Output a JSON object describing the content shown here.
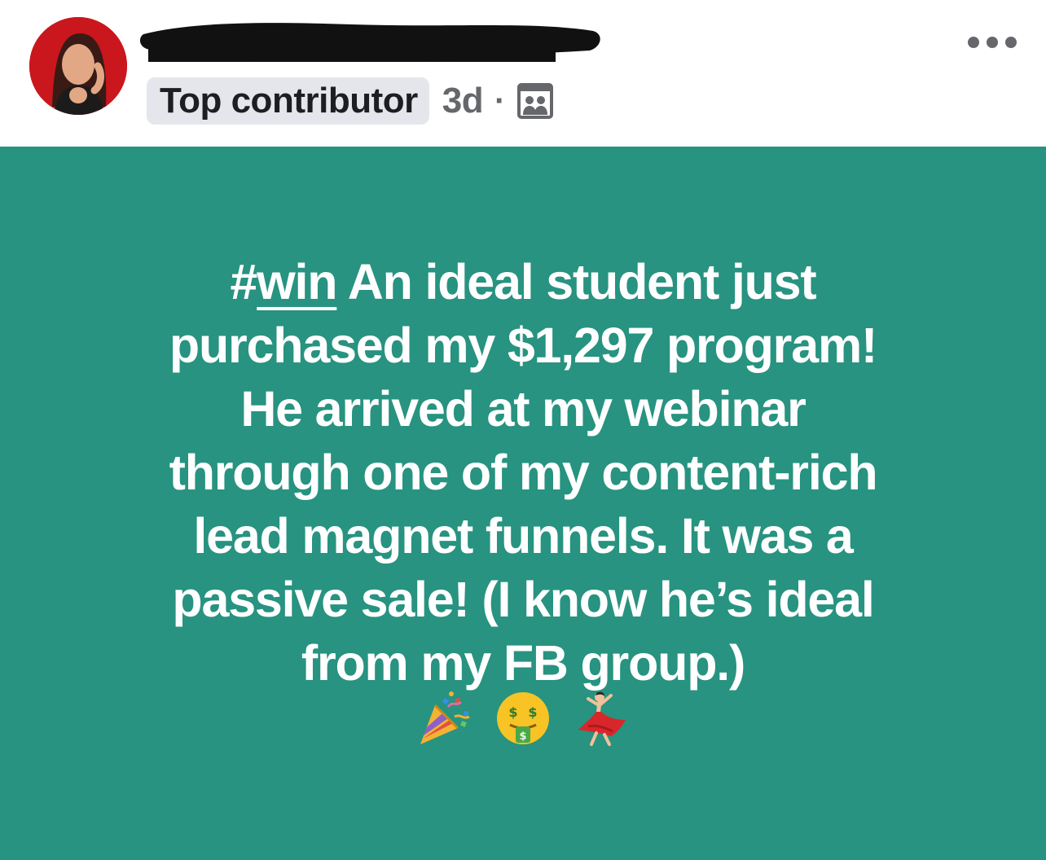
{
  "post": {
    "author_badge": "Top contributor",
    "timestamp": "3d",
    "separator": "·",
    "audience_icon": "group-members-icon",
    "more_icon": "more-options-icon",
    "hashtag_symbol": "#",
    "hashtag_word": "win",
    "text_lines": [
      " An ideal student just",
      "purchased my $1,297 program!",
      "He arrived at my webinar",
      "through one of my content-rich",
      "lead magnet funnels. It was a",
      "passive sale! (I know he’s ideal",
      "from my FB group.)"
    ],
    "emojis": [
      "party-popper-icon",
      "money-mouth-face-icon",
      "dancer-icon"
    ],
    "background_color": "#279380",
    "avatar_frame_color": "#c9171d"
  }
}
